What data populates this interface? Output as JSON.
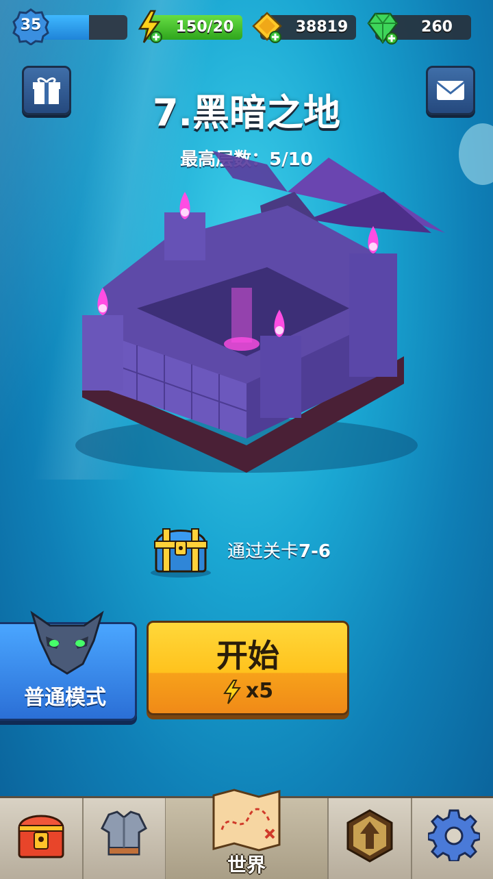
{
  "topbar": {
    "level": "35",
    "xp_fraction": 0.55,
    "energy": "150/20",
    "coins": "38819",
    "gems": "260"
  },
  "stage": {
    "title": "7.黑暗之地",
    "best_floor_label": "最高层数：",
    "best_floor_value": "5/10"
  },
  "reward": {
    "text_prefix": "通过关卡",
    "text_level": "7-6"
  },
  "mode_button": {
    "label": "普通模式"
  },
  "start_button": {
    "label": "开始",
    "cost": "x5"
  },
  "navbar": {
    "world_label": "世界"
  },
  "colors": {
    "start_button": "#ffc21d",
    "mode_button": "#2b6fd6",
    "energy_bar": "#2fa51c",
    "castle_stone": "#6a4fb0",
    "magic_flame": "#ff4de3"
  },
  "icons": [
    "gift-icon",
    "mail-icon",
    "lightning-icon",
    "coin-icon",
    "gem-icon",
    "chest-icon",
    "demon-mask-icon",
    "chest-nav-icon",
    "armor-icon",
    "upgrade-icon",
    "gear-icon",
    "map-icon"
  ]
}
